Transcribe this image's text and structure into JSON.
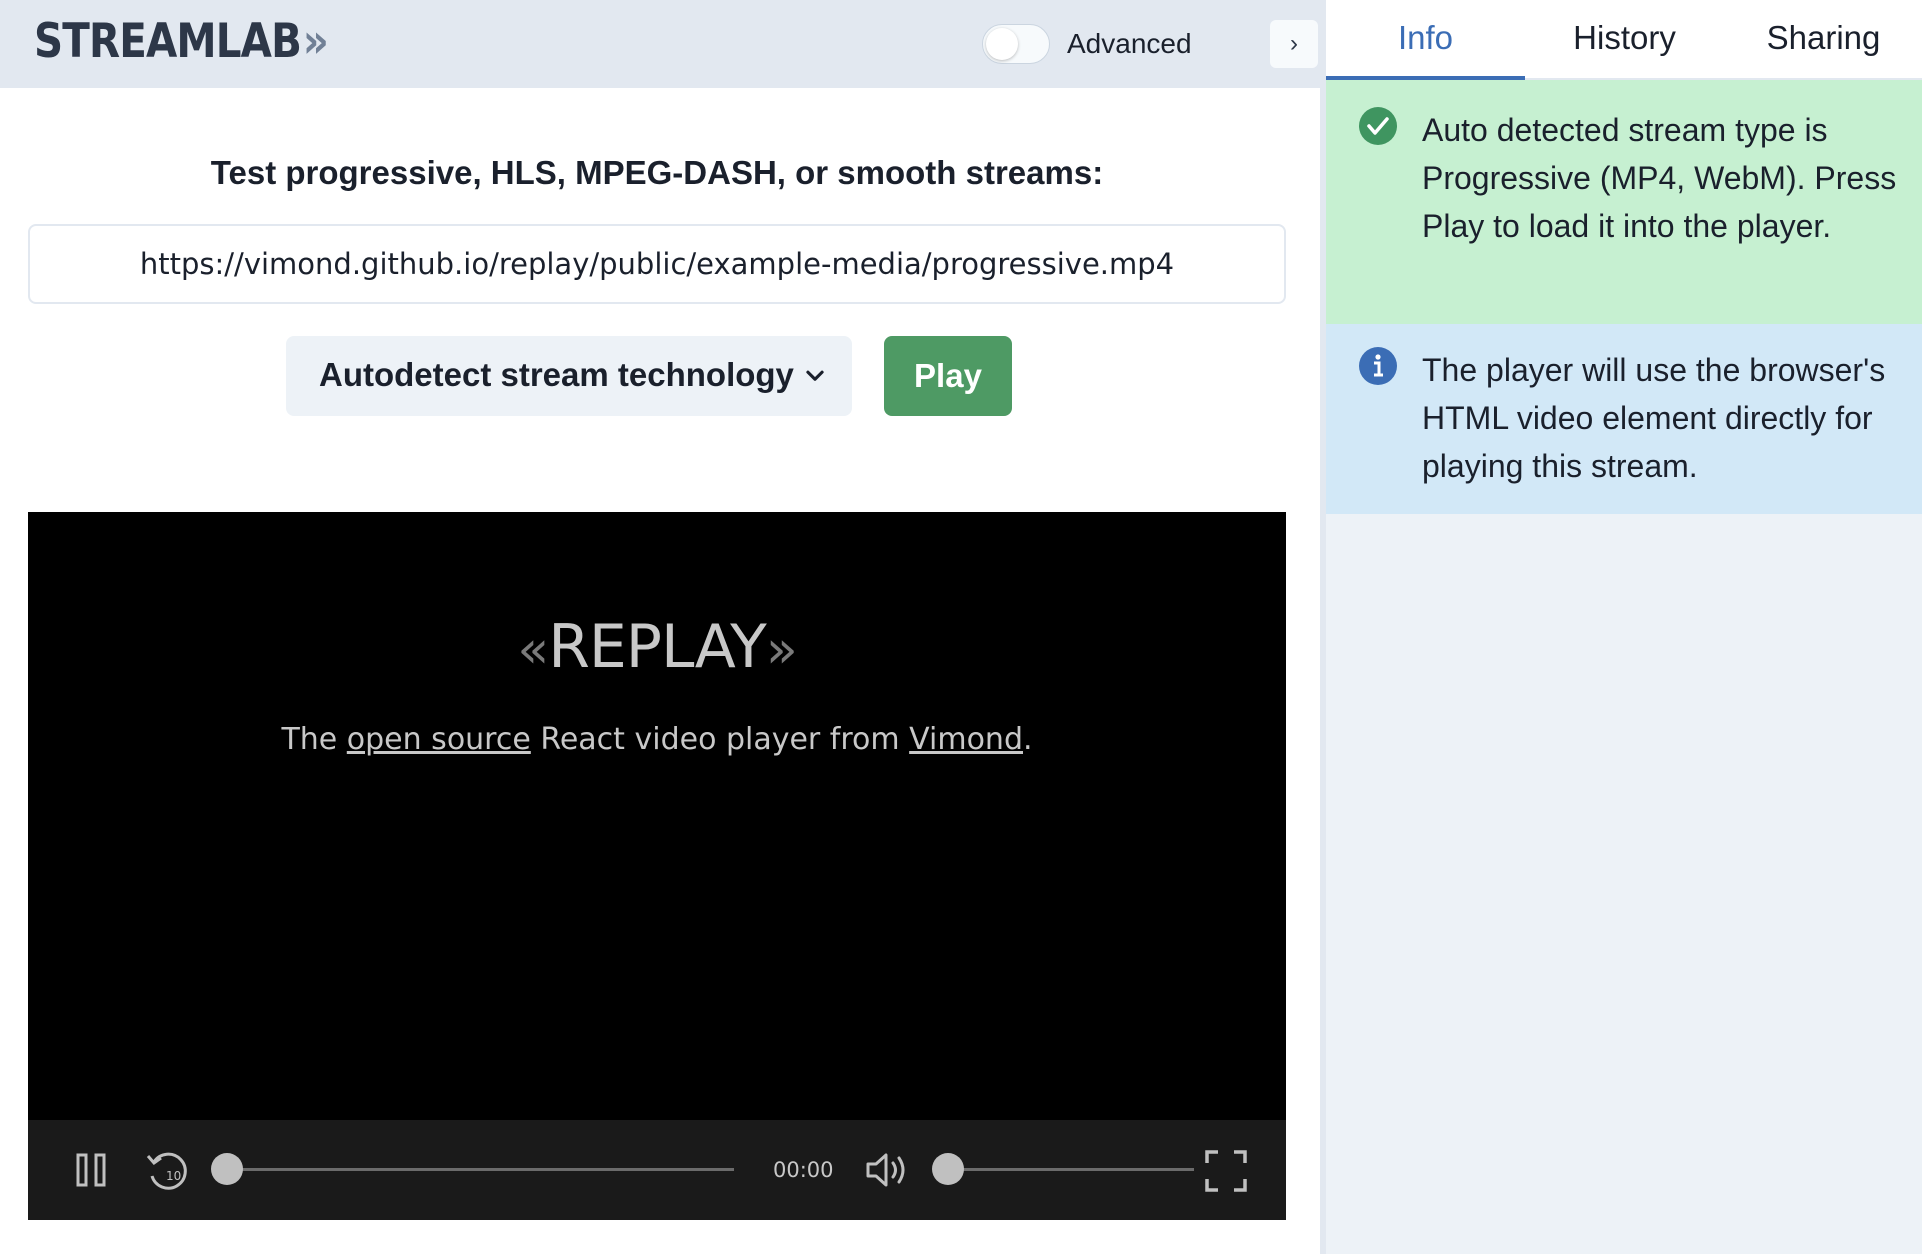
{
  "app": {
    "logo_text": "STREAMLAB",
    "logo_chevrons": "»"
  },
  "header": {
    "advanced_label": "Advanced",
    "advanced_enabled": false,
    "collapse_icon": "chevron-right-icon",
    "collapse_glyph": "›"
  },
  "main": {
    "heading": "Test progressive, HLS, MPEG-DASH, or smooth streams:",
    "url_value": "https://vimond.github.io/replay/public/example-media/progressive.mp4",
    "technology_select": {
      "selected": "Autodetect stream technology"
    },
    "play_label": "Play",
    "play_color": "#4e9a64"
  },
  "player": {
    "logo_left": "«",
    "logo_text": "REPLAY",
    "logo_right": "»",
    "tagline_prefix": "The ",
    "tagline_link1": "open source",
    "tagline_middle": " React video player from ",
    "tagline_link2": "Vimond",
    "tagline_suffix": ".",
    "time": "00:00",
    "progress_fraction": 0,
    "volume_fraction": 0,
    "rewind_label": "10"
  },
  "sidebar": {
    "tabs": [
      {
        "label": "Info",
        "active": true
      },
      {
        "label": "History",
        "active": false
      },
      {
        "label": "Sharing",
        "active": false
      }
    ],
    "accent_color": "#3b6db5",
    "notices": [
      {
        "type": "success",
        "icon": "check-circle-icon",
        "text": "Auto detected stream type is Progressive (MP4, WebM). Press Play to load it into the player."
      },
      {
        "type": "info",
        "icon": "info-circle-icon",
        "text": "The player will use the browser's HTML video element directly for playing this stream."
      }
    ]
  }
}
